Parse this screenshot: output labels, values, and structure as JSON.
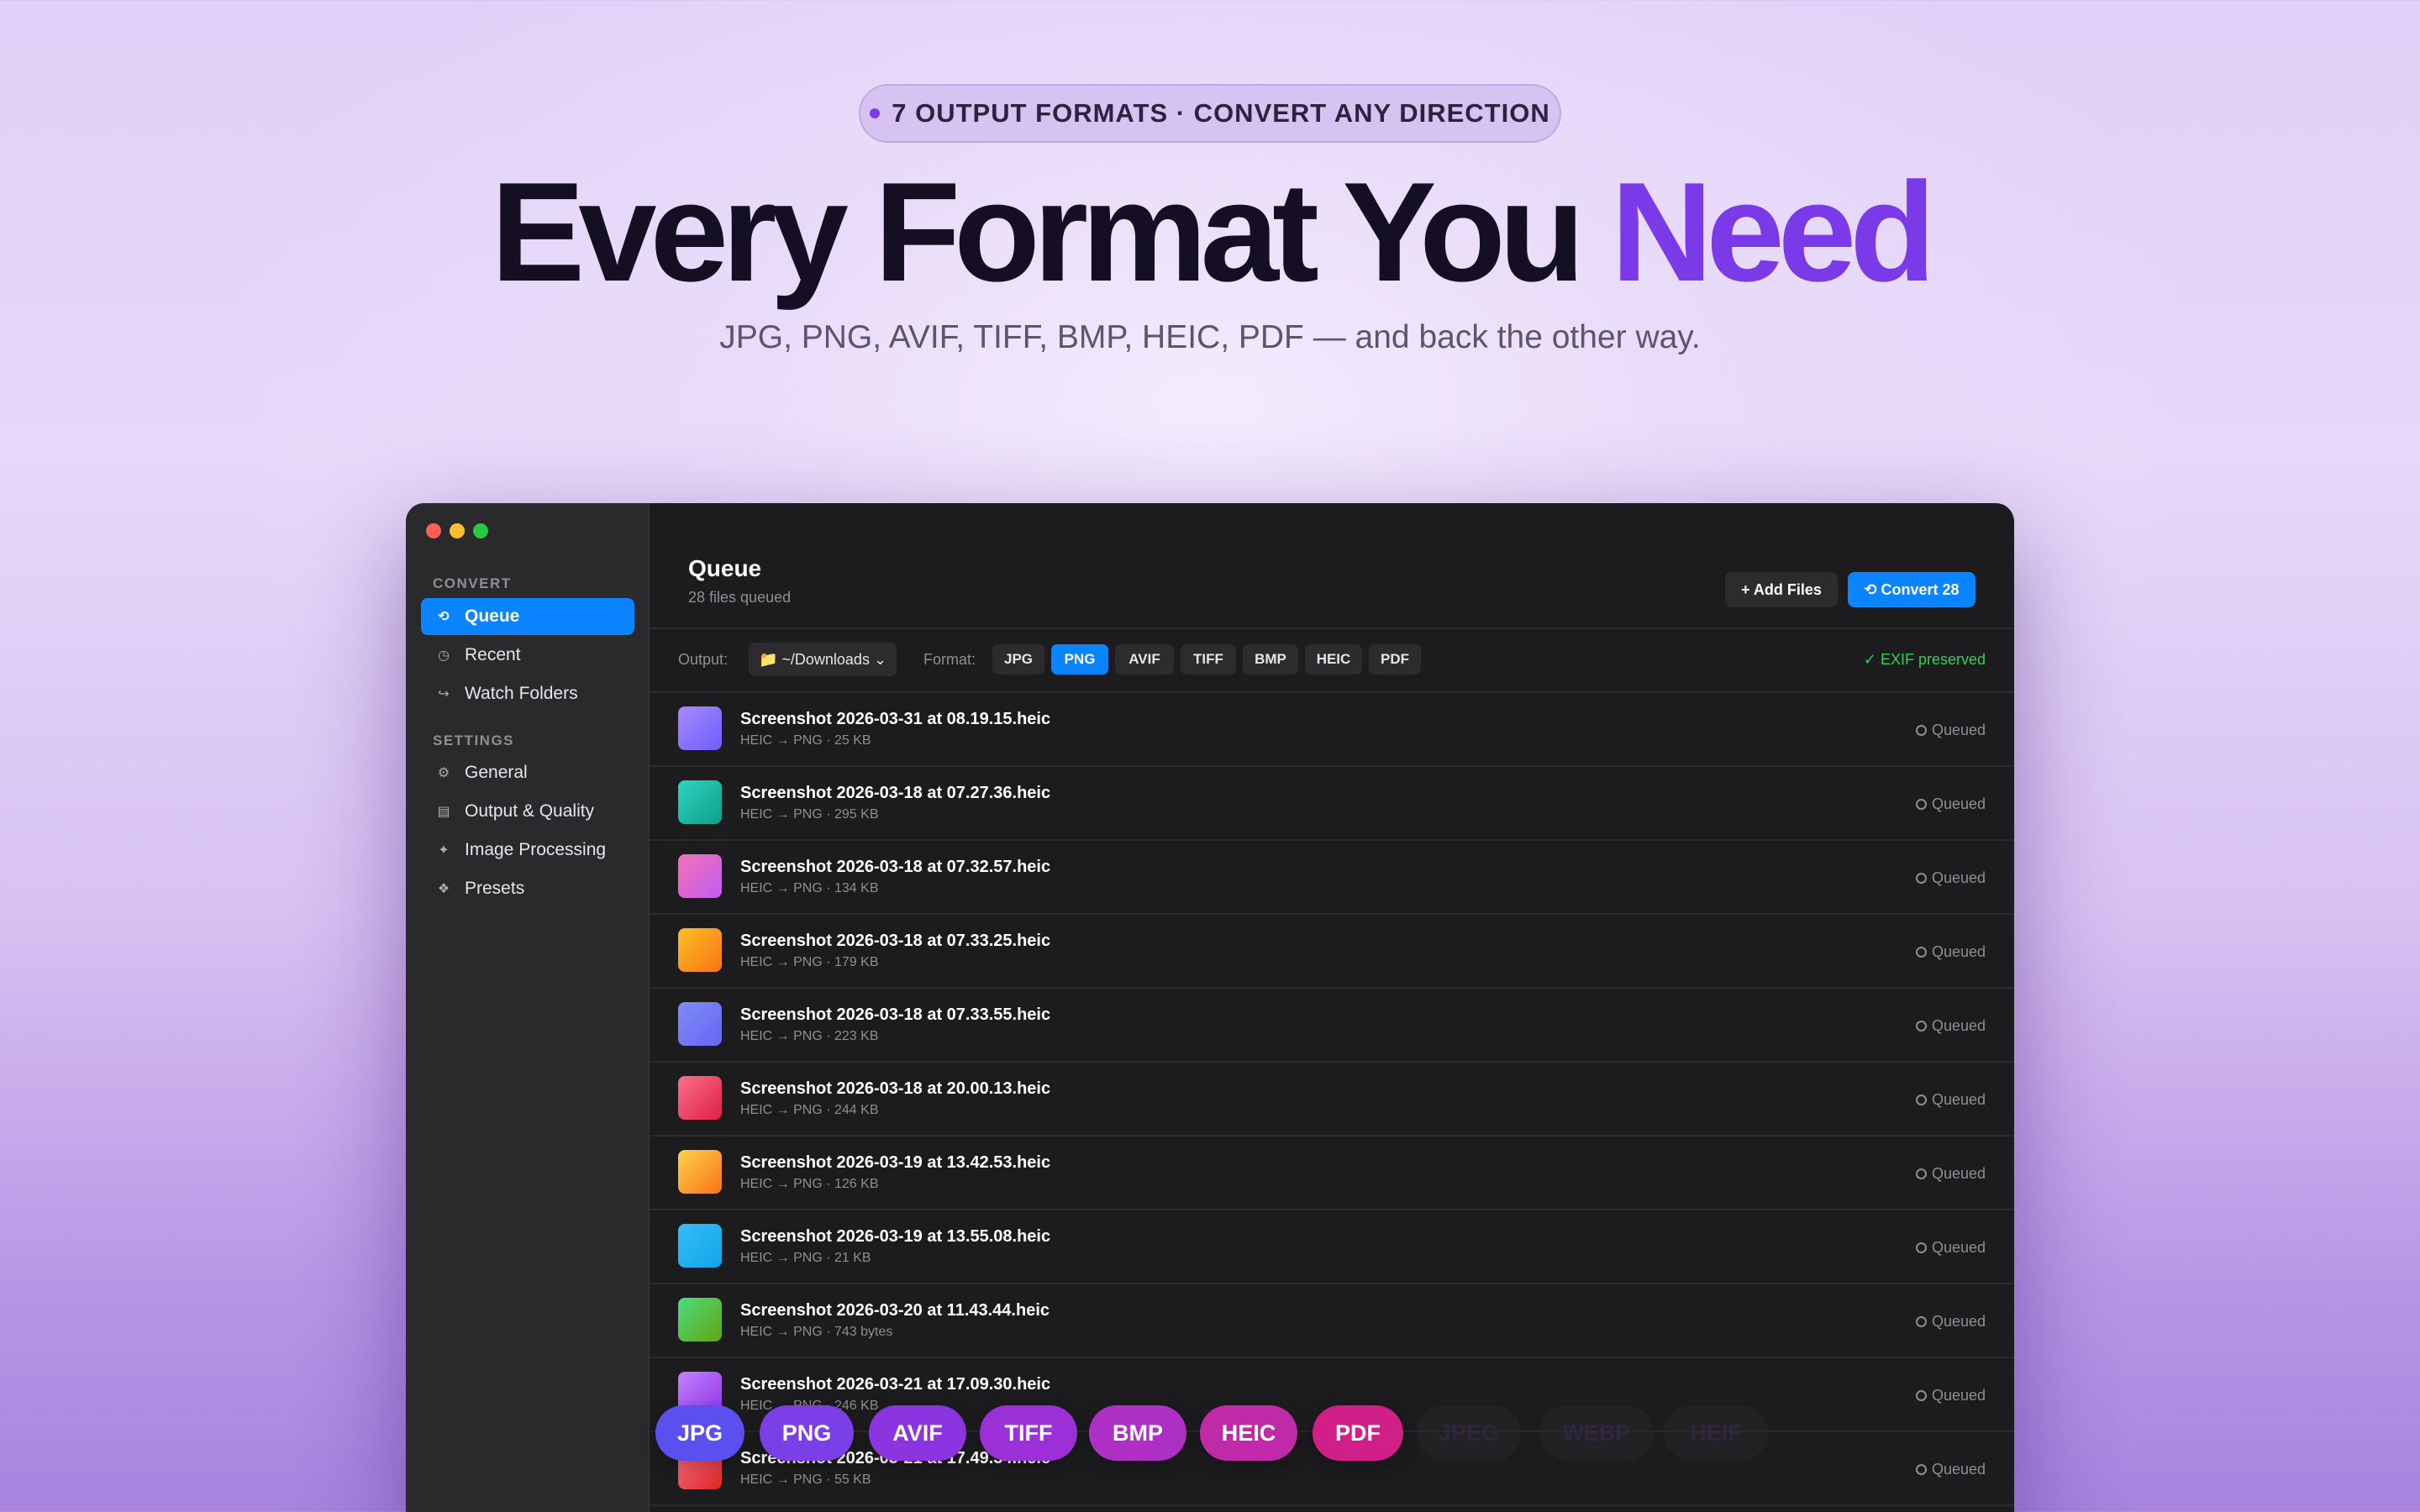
{
  "hero": {
    "pill_text": "7 OUTPUT FORMATS · CONVERT ANY DIRECTION",
    "headline_main": "Every Format You ",
    "headline_accent": "Need",
    "subline": "JPG, PNG, AVIF, TIFF, BMP, HEIC, PDF — and back the other way."
  },
  "sidebar": {
    "convert_label": "CONVERT",
    "convert_items": [
      {
        "label": "Queue",
        "icon": "convert-icon",
        "glyph": "⟲",
        "active": true
      },
      {
        "label": "Recent",
        "icon": "clock-icon",
        "glyph": "◷",
        "active": false
      },
      {
        "label": "Watch Folders",
        "icon": "arrow-icon",
        "glyph": "↪",
        "active": false
      }
    ],
    "settings_label": "SETTINGS",
    "settings_items": [
      {
        "label": "General",
        "icon": "gear-icon",
        "glyph": "⚙"
      },
      {
        "label": "Output & Quality",
        "icon": "image-icon",
        "glyph": "▤"
      },
      {
        "label": "Image Processing",
        "icon": "sparkle-icon",
        "glyph": "✦"
      },
      {
        "label": "Presets",
        "icon": "presets-icon",
        "glyph": "❖"
      }
    ]
  },
  "main": {
    "title": "Queue",
    "subtitle": "28 files queued",
    "add_files_label": "+ Add Files",
    "convert_label": "⟲ Convert 28",
    "output_label": "Output:",
    "output_value": "📁 ~/Downloads ⌄",
    "format_label": "Format:",
    "formats": [
      {
        "label": "JPG",
        "active": false
      },
      {
        "label": "PNG",
        "active": true
      },
      {
        "label": "AVIF",
        "active": false
      },
      {
        "label": "TIFF",
        "active": false
      },
      {
        "label": "BMP",
        "active": false
      },
      {
        "label": "HEIC",
        "active": false
      },
      {
        "label": "PDF",
        "active": false
      }
    ],
    "exif_text": "✓ EXIF preserved",
    "files": [
      {
        "name": "Screenshot 2026-03-31 at 08.19.15.heic",
        "meta": "HEIC → PNG · 25 KB",
        "status": "Queued",
        "color_a": "#a78bfa",
        "color_b": "#6d5dfc"
      },
      {
        "name": "Screenshot 2026-03-18 at 07.27.36.heic",
        "meta": "HEIC → PNG · 295 KB",
        "status": "Queued",
        "color_a": "#2dd4bf",
        "color_b": "#0f9f8a"
      },
      {
        "name": "Screenshot 2026-03-18 at 07.32.57.heic",
        "meta": "HEIC → PNG · 134 KB",
        "status": "Queued",
        "color_a": "#f472b6",
        "color_b": "#c05cf0"
      },
      {
        "name": "Screenshot 2026-03-18 at 07.33.25.heic",
        "meta": "HEIC → PNG · 179 KB",
        "status": "Queued",
        "color_a": "#fbbf24",
        "color_b": "#f97316"
      },
      {
        "name": "Screenshot 2026-03-18 at 07.33.55.heic",
        "meta": "HEIC → PNG · 223 KB",
        "status": "Queued",
        "color_a": "#818cf8",
        "color_b": "#6366f1"
      },
      {
        "name": "Screenshot 2026-03-18 at 20.00.13.heic",
        "meta": "HEIC → PNG · 244 KB",
        "status": "Queued",
        "color_a": "#fb7185",
        "color_b": "#e11d48"
      },
      {
        "name": "Screenshot 2026-03-19 at 13.42.53.heic",
        "meta": "HEIC → PNG · 126 KB",
        "status": "Queued",
        "color_a": "#fcd34d",
        "color_b": "#f97316"
      },
      {
        "name": "Screenshot 2026-03-19 at 13.55.08.heic",
        "meta": "HEIC → PNG · 21 KB",
        "status": "Queued",
        "color_a": "#38bdf8",
        "color_b": "#0ea5e9"
      },
      {
        "name": "Screenshot 2026-03-20 at 11.43.44.heic",
        "meta": "HEIC → PNG · 743 bytes",
        "status": "Queued",
        "color_a": "#4ade80",
        "color_b": "#65a30d"
      },
      {
        "name": "Screenshot 2026-03-21 at 17.09.30.heic",
        "meta": "HEIC → PNG · 246 KB",
        "status": "Queued",
        "color_a": "#c084fc",
        "color_b": "#9333ea"
      },
      {
        "name": "Screenshot 2026-03-21 at 17.49.34.heic",
        "meta": "HEIC → PNG · 55 KB",
        "status": "Queued",
        "color_a": "#fb7185",
        "color_b": "#dc2626"
      }
    ]
  },
  "format_pills": [
    {
      "label": "JPG",
      "color": "#5b4ff0",
      "ghost": false
    },
    {
      "label": "PNG",
      "color": "#7a3fe6",
      "ghost": false
    },
    {
      "label": "AVIF",
      "color": "#8b34e0",
      "ghost": false
    },
    {
      "label": "TIFF",
      "color": "#9c30d8",
      "ghost": false
    },
    {
      "label": "BMP",
      "color": "#ae2fc4",
      "ghost": false
    },
    {
      "label": "HEIC",
      "color": "#c02aa8",
      "ghost": false
    },
    {
      "label": "PDF",
      "color": "#d01f86",
      "ghost": false
    },
    {
      "label": "JPEG",
      "color": "",
      "ghost": true
    },
    {
      "label": "WEBP",
      "color": "",
      "ghost": true
    },
    {
      "label": "HEIF",
      "color": "",
      "ghost": true
    }
  ]
}
